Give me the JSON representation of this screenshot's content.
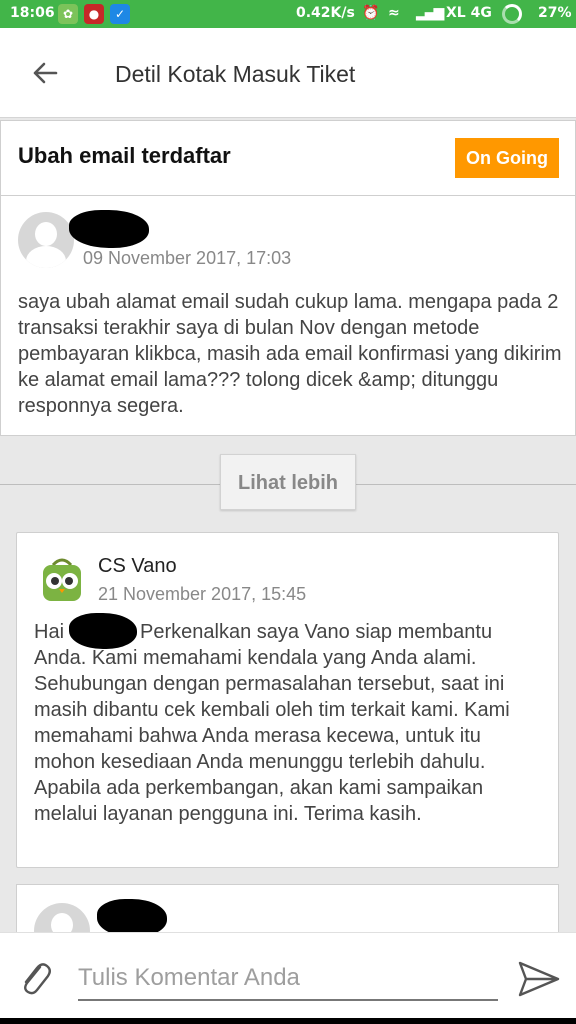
{
  "status_bar": {
    "time": "18:06",
    "speed": "0.42K/s",
    "carrier": "XL 4G",
    "battery": "27%",
    "bg_color": "#42b549"
  },
  "header": {
    "title": "Detil Kotak Masuk Tiket",
    "back_icon": "arrow-left-icon"
  },
  "ticket": {
    "subject": "Ubah email terdaftar",
    "status": "On Going",
    "status_color": "#ff9800"
  },
  "messages": [
    {
      "author": "",
      "date": "09 November 2017, 17:03",
      "text": "saya ubah alamat email sudah cukup lama. mengapa pada 2 transaksi terakhir saya di bulan Nov dengan metode pembayaran klikbca, masih ada email konfirmasi yang dikirim ke alamat email lama??? tolong dicek &amp; ditunggu responnya segera."
    },
    {
      "author": "CS Vano",
      "date": "21 November 2017, 15:45",
      "greeting": "Hai",
      "text": "Perkenalkan saya Vano siap membantu Anda. Kami memahami kendala yang Anda alami. Sehubungan dengan permasalahan tersebut, saat ini masih dibantu cek kembali oleh tim terkait kami. Kami memahami bahwa Anda merasa kecewa, untuk itu mohon kesediaan Anda menunggu terlebih dahulu. Apabila ada perkembangan, akan kami sampaikan melalui layanan pengguna ini. Terima kasih."
    }
  ],
  "load_more": {
    "label": "Lihat lebih"
  },
  "composer": {
    "placeholder": "Tulis Komentar Anda",
    "attach_icon": "paperclip-icon",
    "send_icon": "send-icon"
  }
}
